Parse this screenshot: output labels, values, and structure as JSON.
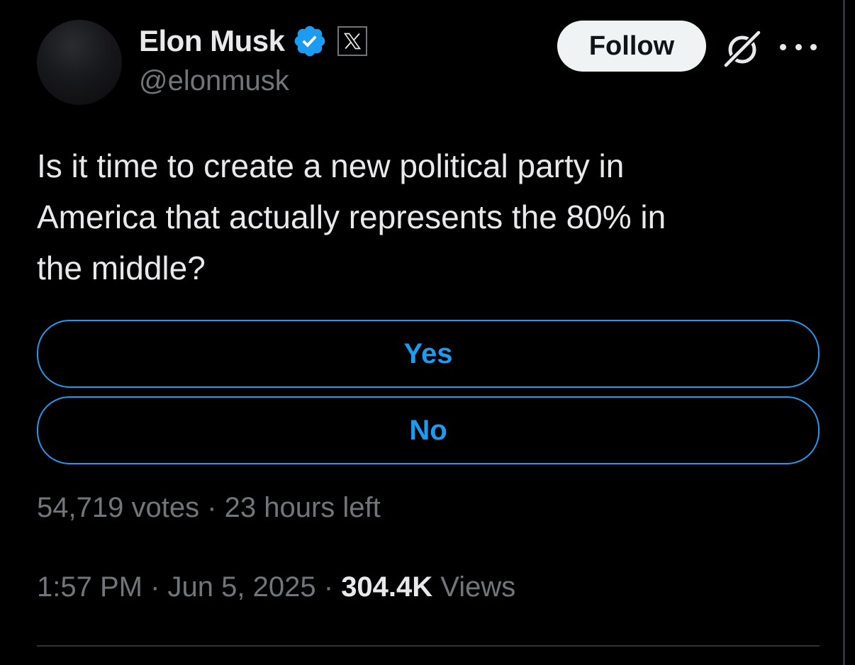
{
  "author": {
    "display_name": "Elon Musk",
    "handle": "@elonmusk",
    "verified_icon": "verified-badge-icon",
    "affiliation_icon": "x-logo-icon"
  },
  "header": {
    "follow_label": "Follow",
    "grok_icon": "grok-icon",
    "more_icon": "more-options-icon"
  },
  "tweet": {
    "text": "Is it time to create a new political party in\nAmerica that actually represents the 80% in\nthe middle?"
  },
  "poll": {
    "options": [
      "Yes",
      "No"
    ],
    "votes": "54,719 votes",
    "separator": "·",
    "time_left": "23 hours left"
  },
  "meta": {
    "time": "1:57 PM",
    "separator": "·",
    "date": "Jun 5, 2025",
    "views_count": "304.4K",
    "views_label": "Views"
  },
  "colors": {
    "background": "#000000",
    "text_primary": "#e7e9ea",
    "text_secondary": "#71767b",
    "accent": "#1d9bf0",
    "follow_bg": "#eff3f4",
    "divider": "#2f3336"
  }
}
